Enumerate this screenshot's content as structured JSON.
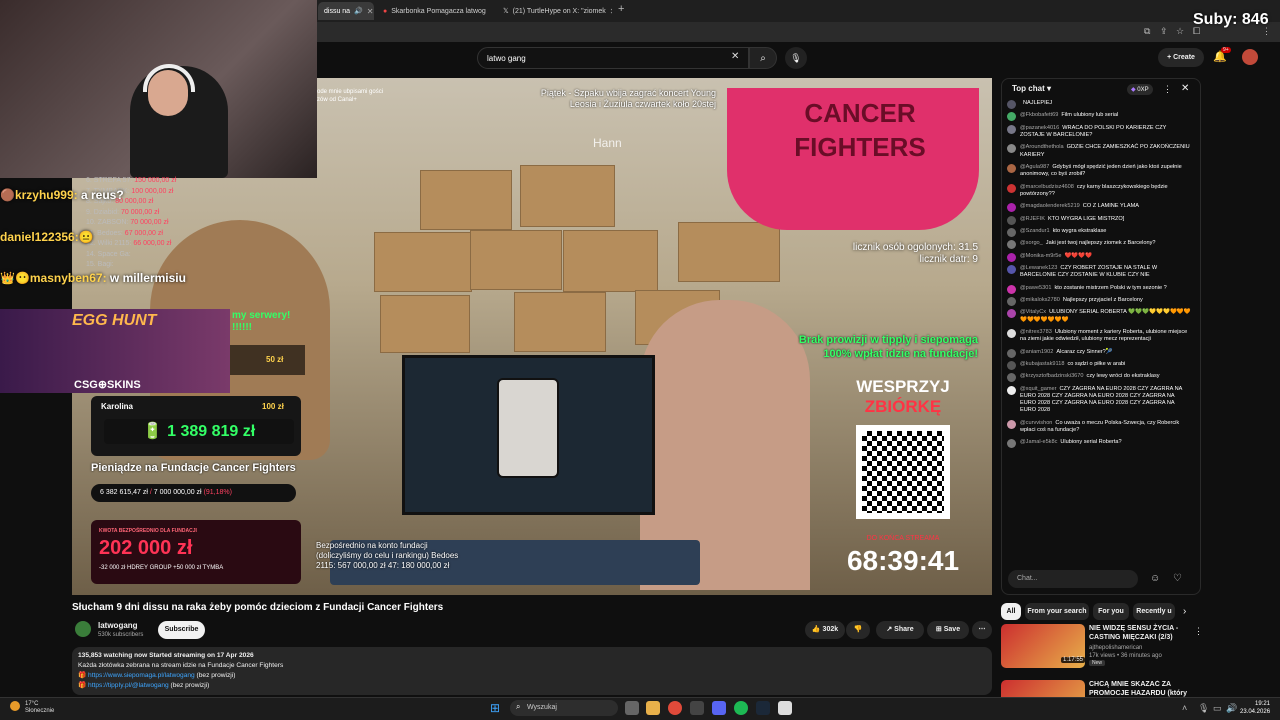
{
  "browser": {
    "tabs": [
      {
        "label": "dissu na",
        "active": true
      },
      {
        "label": "Skarbonka Pomagacza latwog",
        "active": false
      },
      {
        "label": "(21) TurtleHype on X: \"ziomek",
        "active": false
      }
    ],
    "new_tab": "+"
  },
  "stream_overlay": {
    "subs_counter": "Suby: 846",
    "chat_popups": [
      {
        "user": "krzyhu999:",
        "text": " a reus?"
      },
      {
        "user": "daniel122356:",
        "text": ""
      },
      {
        "user": "masnyben67:",
        "text": " w millermisiu"
      }
    ],
    "ranking": [
      {
        "name": "6. STREFA 57:",
        "amount": "150 000,00 zł"
      },
      {
        "name": "7. TYMBARK:",
        "amount": "100 000,00 zł"
      },
      {
        "name": "8. Sajko:",
        "amount": "80 000,00 zł"
      },
      {
        "name": "9. Dziabid:",
        "amount": "70 000,00 zł"
      },
      {
        "name": "10. ZABSON:",
        "amount": "70 000,00 zł"
      },
      {
        "name": "11. Bedoes:",
        "amount": "67 000,00 zł"
      },
      {
        "name": "12. Wilki 2115:",
        "amount": "66 000,00 zł"
      },
      {
        "name": "14. Space Ga:",
        "amount": ""
      },
      {
        "name": "15. Bagi:",
        "amount": ""
      }
    ],
    "egg_hunt": "EGG HUNT",
    "csgo_skins": "CSG⊕SKINS",
    "my_serwery": "my serwery! !!!!!!",
    "donation_small": "50 zł",
    "donation": {
      "name": "Karolina",
      "amount": "100 zł",
      "total": "1 389 819 zł"
    },
    "pieniadze_label": "Pieniądze na Fundacje Cancer Fighters",
    "progress": {
      "current": "6 382 615,47 zł",
      "separator": "/",
      "goal": "7 000 000,00 zł",
      "percent": "(91,18%)",
      "fraction": 0.9118
    },
    "kwota": {
      "label": "KWOTA BEZPOŚREDNIO DLA FUNDACJI",
      "amount": "202 000 zł",
      "sub": "-32 000 zł  HDREY GROUP  +50 000 zł  TYMBA"
    }
  },
  "video_scene": {
    "top_left_note": "ode mnie ubpisami gości zów od Canal+",
    "top_note": "Piątek - Szpaku wbija zagrać koncert Young Leosia i Żuziula czwartek koło 20stej",
    "hanna": "Hann",
    "cancer_text": "CANCER FIGHTERS",
    "counters": [
      "licznik osób ogolonych: 31.5",
      "licznik datr: 9"
    ],
    "brak": "Brak prowizji w tipply i siepomaga 100% wpłat idzie na fundacje!",
    "wesprzyj": "WESPRZYJ",
    "zbiorke": "ZBIÓRKĘ",
    "do_konca": "DO KOŃCA STREAMA",
    "timer": "68:39:41",
    "bezp": "Bezpośrednio na konto fundacji (doliczyliśmy do celu i rankingu) Bedoes 2115: 567 000,00 zł 47: 180 000,00 zł"
  },
  "youtube": {
    "search_value": "latwo gang",
    "create_label": "Create",
    "notif_count": "9+",
    "video_title": "Słucham 9 dni dissu na raka żeby pomóc dzieciom z Fundacji Cancer Fighters",
    "channel": {
      "name": "latwogang",
      "subs": "530k subscribers",
      "subscribe": "Subscribe"
    },
    "actions": {
      "likes": "302k",
      "share": "Share",
      "save": "Save",
      "more": "⋯"
    },
    "description": {
      "stats": "135,853 watching now  Started streaming on 17 Apr 2026",
      "line1": "Każda złotówka zebrana na stream idzie na Fundacje Cancer Fighters",
      "link1": "https://www.siepomaga.pl/latwogang",
      "link1_note": " (bez prowizji)",
      "link2": "https://tippIy.pl/@latwogang",
      "link2_note": " (bez prowizji)"
    }
  },
  "chat": {
    "header": "Top chat",
    "xp": "0XP",
    "input_placeholder": "Chat...",
    "messages": [
      {
        "user": "",
        "text": "NAJLEPIEJ",
        "color": "#556"
      },
      {
        "user": "@Fkbobafett69",
        "text": "Film ulubiony lub serial",
        "color": "#4a6"
      },
      {
        "user": "@pazanek4016",
        "text": "WRACA DO POLSKI PO KARIERZE CZY ZOSTAJE W BARCELONIE?",
        "color": "#778"
      },
      {
        "user": "@Aroundthethola",
        "text": "GDZIE CHCE ZAMIESZKAĆ PO ZAKOŃCZENIU KARIERY",
        "color": "#888"
      },
      {
        "user": "@Agula987",
        "text": "Gdybyś mógł spędzić jeden dzień jako ktoś zupełnie anonimowy, co byś zrobił?",
        "color": "#a64"
      },
      {
        "user": "@marcelbudzisz4608",
        "text": "czy karny blaszczykowskiego będzie powtórzony??",
        "color": "#c33"
      },
      {
        "user": "@magdaolenderek5219",
        "text": "CO Z LAMINE YLAMA",
        "color": "#a2a"
      },
      {
        "user": "@RJEFIK",
        "text": "KTO WYGRA LIGE MISTRZO]",
        "color": "#555"
      },
      {
        "user": "@Szandur1",
        "text": "kto wygra ekstraklase",
        "color": "#666"
      },
      {
        "user": "@sorgo_",
        "text": "Jaki jest twoj najlepszy ziomek z Barcelony?",
        "color": "#777"
      },
      {
        "user": "@Monika-m9r5e",
        "text": "❤️❤️❤️❤️",
        "color": "#a2a"
      },
      {
        "user": "@Lewanek123",
        "text": "CZY ROBERT ZOSTAJE NA STALE W BARCELONIE CZY ZOSTANIE W KLUBIE CZY NIE",
        "color": "#55a"
      },
      {
        "user": "@pawe5301",
        "text": "kto zostanie mistrzem Polski w tym sezonie ?",
        "color": "#c3a"
      },
      {
        "user": "@mikaloks2780",
        "text": "Najlepszy przyjaciel z Barcelony",
        "color": "#666"
      },
      {
        "user": "@VitalyCx",
        "text": "ULUBIONY SERIAL ROBERTA 💚💚💚💛💛💛🧡🧡🧡🧡🧡🧡🧡🧡🧡🧡",
        "color": "#a4a"
      },
      {
        "user": "@nitrex3783",
        "text": "Ulubiony moment z kariery Roberta, ulubione miejsce na ziemi jakie odwiedził, ulubiony mecz reprezentacji",
        "color": "#ddd"
      },
      {
        "user": "@aniam1902",
        "text": "Alcaraz czy Sinner?🎾",
        "color": "#666"
      },
      {
        "user": "@kubajastak9118",
        "text": "co sądzi o piłke w arabi",
        "color": "#555"
      },
      {
        "user": "@krzysztofbadzinski3670",
        "text": "czy lewy wróci do ekstraklasy",
        "color": "#666"
      },
      {
        "user": "@xquit_gamer",
        "text": "CZY ZAGRRA NA EURO 2028 CZY ZAGRRA NA EURO 2028 CZY ZAGRRA NA EURO 2028 CZY ZAGRRA NA EURO 2028 CZY ZAGRRA NA EURO 2028 CZY ZAGRRA NA EURO 2028",
        "color": "#eee"
      },
      {
        "user": "@curvvishon",
        "text": "Co uważa o meczu Polska-Szwecja, czy Robercik wpłaci coś na fundacje?",
        "color": "#c9a"
      },
      {
        "user": "@Jamal-e5k8c",
        "text": "Ulubiony serial Roberta?",
        "color": "#777"
      }
    ]
  },
  "recommendations": {
    "chips": [
      {
        "label": "All",
        "active": true
      },
      {
        "label": "From your search",
        "active": false
      },
      {
        "label": "For you",
        "active": false
      },
      {
        "label": "Recently u",
        "active": false
      }
    ],
    "items": [
      {
        "title": "NIE WIDZĘ SENSU ŻYCIA - CASTING MIĘCZAKI (2/3)",
        "channel": "ajthepolishamerican",
        "meta": "17k views • 36 minutes ago",
        "badge": "New",
        "duration": "1:17:55"
      },
      {
        "title": "CHCĄ MNIE SKAZAĆ ZA PROMOCJE HAZARDU (który",
        "channel": "",
        "meta": "",
        "badge": "",
        "duration": ""
      }
    ]
  },
  "taskbar": {
    "weather_temp": "17°C",
    "weather_desc": "Słonecznie",
    "search_placeholder": "Wyszukaj",
    "time": "19:21",
    "date": "23.04.2026"
  }
}
